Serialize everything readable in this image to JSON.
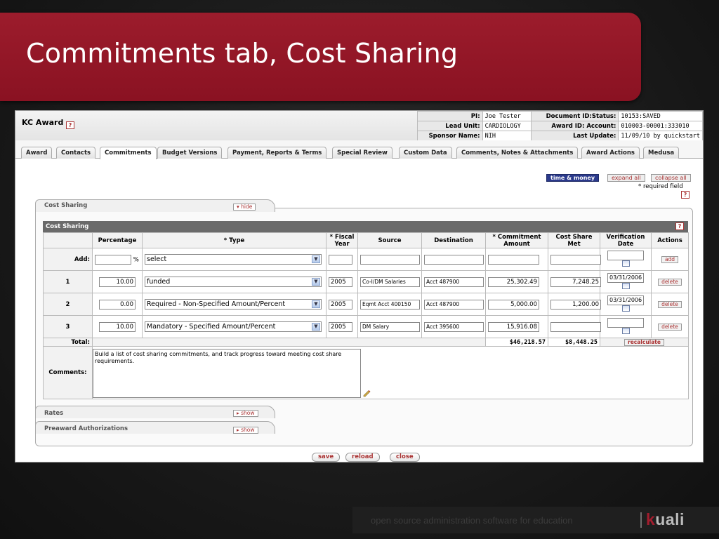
{
  "slide": {
    "title": "Commitments tab, Cost Sharing",
    "footer_text": "open source administration software for education",
    "logo_k": "k",
    "logo_rest": "uali"
  },
  "app": {
    "title": "KC Award",
    "help_label": "?",
    "header": {
      "pi_label": "PI:",
      "pi_value": "Joe Tester",
      "doc_status_label": "Document ID:Status:",
      "doc_status_value": "10153:SAVED",
      "lead_unit_label": "Lead Unit:",
      "lead_unit_value": "CARDIOLOGY",
      "award_account_label": "Award ID: Account:",
      "award_account_value": "010003-00001:333010",
      "sponsor_label": "Sponsor Name:",
      "sponsor_value": "NIH",
      "last_update_label": "Last Update:",
      "last_update_value": "11/09/10 by quickstart"
    },
    "tabs": [
      "Award",
      "Contacts",
      "Commitments",
      "Budget Versions",
      "Payment, Reports & Terms",
      "Special Review",
      "Custom Data",
      "Comments, Notes & Attachments",
      "Award Actions",
      "Medusa"
    ],
    "toolbar": {
      "time_money": "time & money",
      "expand_all": "expand all",
      "collapse_all": "collapse all",
      "required_note": "* required field"
    },
    "sections": {
      "cost_sharing_tab": "Cost Sharing",
      "hide": "▾ hide",
      "cost_sharing_bar": "Cost Sharing",
      "rates": "Rates",
      "preaward": "Preaward Authorizations",
      "show": "▸ show"
    },
    "grid": {
      "headers": [
        "Percentage",
        "* Type",
        "* Fiscal Year",
        "Source",
        "Destination",
        "* Commitment Amount",
        "Cost Share Met",
        "Verification Date",
        "Actions"
      ],
      "add_label": "Add:",
      "percent_sign": "%",
      "add_type": "select",
      "add_button": "add",
      "rows": [
        {
          "num": "1",
          "percentage": "10.00",
          "type": "funded",
          "fiscal_year": "2005",
          "source": "Co-I/DM Salaries",
          "destination": "Acct 487900",
          "commitment": "25,302.49",
          "met": "7,248.25",
          "date": "03/31/2006",
          "action": "delete"
        },
        {
          "num": "2",
          "percentage": "0.00",
          "type": "Required - Non-Specified Amount/Percent",
          "fiscal_year": "2005",
          "source": "Eqmt Acct 400150",
          "destination": "Acct 487900",
          "commitment": "5,000.00",
          "met": "1,200.00",
          "date": "03/31/2006",
          "action": "delete"
        },
        {
          "num": "3",
          "percentage": "10.00",
          "type": "Mandatory - Specified Amount/Percent",
          "fiscal_year": "2005",
          "source": "DM Salary",
          "destination": "Acct 395600",
          "commitment": "15,916.08",
          "met": "",
          "date": "",
          "action": "delete"
        }
      ],
      "total_label": "Total:",
      "total_commitment": "$46,218.57",
      "total_met": "$8,448.25",
      "recalculate": "recalculate",
      "comments_label": "Comments:",
      "comments_text": "Build a list of cost sharing commitments, and track progress toward meeting cost share requirements."
    },
    "buttons": {
      "save": "save",
      "reload": "reload",
      "close": "close"
    }
  },
  "colors": {
    "banner": "#9c1c2c",
    "accent_link": "#a33333",
    "time_money_bg": "#2b3a8c"
  }
}
